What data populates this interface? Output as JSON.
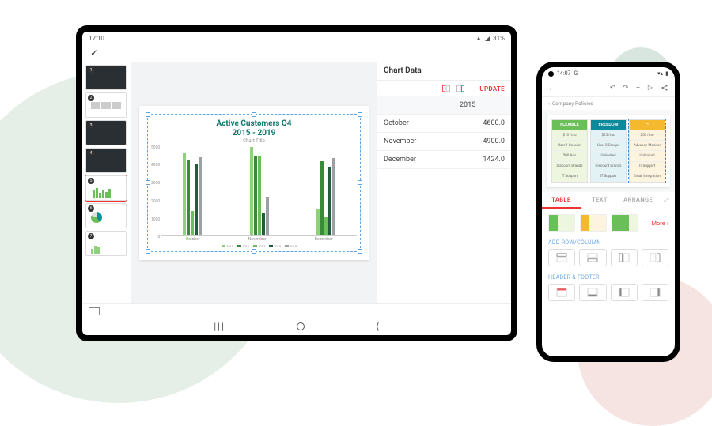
{
  "tablet": {
    "status": {
      "time": "12:10",
      "battery": "31%"
    },
    "chart_panel": {
      "title": "Chart Data",
      "update_label": "UPDATE",
      "year_header": "2015",
      "rows": [
        {
          "label": "October",
          "value": "4600.0"
        },
        {
          "label": "November",
          "value": "4900.0"
        },
        {
          "label": "December",
          "value": "1424.0"
        }
      ]
    },
    "slide_chart": {
      "title": "Active Customers Q4",
      "title_line2": "2015 - 2019",
      "subtitle": "Chart Title",
      "xaxis_label": ""
    },
    "nav": {
      "recents": "|||",
      "home": "○",
      "back": "‹"
    }
  },
  "phone": {
    "status": {
      "time": "14:07",
      "carrier": "G"
    },
    "breadcrumb": {
      "icon": "‹",
      "doc": "Company Policies"
    },
    "toolbar": {
      "back": "←",
      "undo": "↶",
      "redo": "↷",
      "add": "+",
      "play": "▷",
      "share": "‹›"
    },
    "table_preview": {
      "columns": [
        {
          "header": "FLEXIBLE",
          "color": "#6bbf59",
          "bg": "#eef6e0"
        },
        {
          "header": "FREEDOM",
          "color": "#0a8a9a",
          "bg": "#e3f2f4"
        },
        {
          "header": "—",
          "color": "#f4b92f",
          "bg": "#fdf4df"
        }
      ],
      "rows": [
        [
          "$10 /mo",
          "$25 /mo",
          "$50 /mo"
        ],
        [
          "User 1 Session",
          "User 2 Groups",
          "Advance Monitor"
        ],
        [
          "500 Ads",
          "Unlimited",
          "Unlimited"
        ],
        [
          "Discount Brands",
          "Discount Brands",
          "IT Support"
        ],
        [
          "IT Support",
          "IT Support",
          "Email Integration"
        ]
      ]
    },
    "tabs": {
      "table": "TABLE",
      "text": "TEXT",
      "arrange": "ARRANGE"
    },
    "more_label": "More",
    "sections": {
      "add": "ADD ROW/COLUMN",
      "header_footer": "HEADER & FOOTER"
    }
  },
  "chart_data": {
    "type": "bar",
    "title": "Active Customers Q4 2015 - 2019",
    "xlabel": "",
    "ylabel": "",
    "ylim": [
      0,
      5000
    ],
    "yticks": [
      5000,
      4000,
      3000,
      2000,
      1000,
      0
    ],
    "categories": [
      "October",
      "November",
      "December"
    ],
    "series": [
      {
        "name": "2015",
        "color": "#8fd17a",
        "values": [
          4600,
          4900,
          1424
        ]
      },
      {
        "name": "2016",
        "color": "#3a8a3a",
        "values": [
          4200,
          4350,
          4100
        ]
      },
      {
        "name": "2017",
        "color": "#6bbf59",
        "values": [
          1300,
          4400,
          950
        ]
      },
      {
        "name": "2018",
        "color": "#1f5e3c",
        "values": [
          3900,
          1200,
          3800
        ]
      },
      {
        "name": "2019",
        "color": "#9aa0a4",
        "values": [
          4300,
          2100,
          4250
        ]
      }
    ]
  }
}
